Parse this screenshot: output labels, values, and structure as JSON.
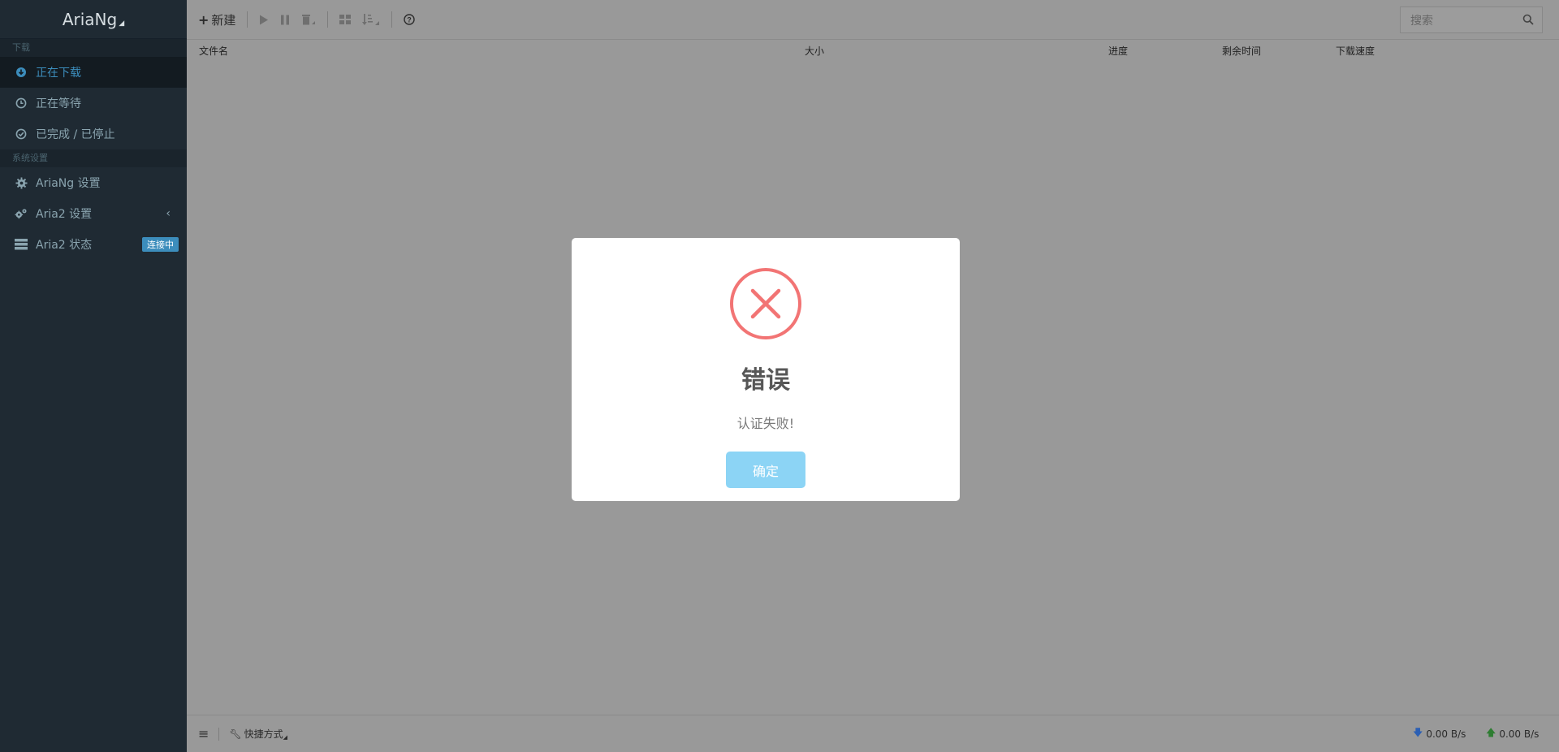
{
  "app": {
    "title": "AriaNg"
  },
  "sidebar": {
    "download_header": "下载",
    "downloads": [
      {
        "label": "正在下载",
        "icon": "download-circle-icon",
        "active": true
      },
      {
        "label": "正在等待",
        "icon": "clock-icon"
      },
      {
        "label": "已完成 / 已停止",
        "icon": "check-circle-icon"
      }
    ],
    "settings_header": "系统设置",
    "settings": [
      {
        "label": "AriaNg 设置",
        "icon": "gear-icon"
      },
      {
        "label": "Aria2 设置",
        "icon": "gears-icon"
      },
      {
        "label": "Aria2 状态",
        "icon": "server-icon",
        "badge": "连接中"
      }
    ]
  },
  "toolbar": {
    "new_label": "新建",
    "search_placeholder": "搜索"
  },
  "table": {
    "columns": [
      "文件名",
      "大小",
      "进度",
      "剩余时间",
      "下载速度"
    ]
  },
  "footer": {
    "shortcut_label": "快捷方式",
    "download_speed": "0.00 B/s",
    "upload_speed": "0.00 B/s"
  },
  "modal": {
    "title": "错误",
    "message": "认证失败!",
    "confirm_label": "确定"
  },
  "colors": {
    "accent": "#3c8dbc",
    "error": "#f27474",
    "confirm_button": "#8cd4f5"
  }
}
